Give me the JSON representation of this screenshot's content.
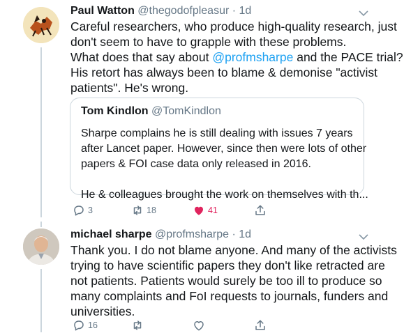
{
  "tweets": [
    {
      "name": "Paul Watton",
      "handle": "@thegodofpleasur",
      "time": "· 1d",
      "avatar": "painted-icon-avatar",
      "lines": [
        "Careful researchers, who produce high-quality research, just",
        "don't seem to have to grapple with these problems.",
        "What does that say about ",
        "@profmsharpe",
        " and the PACE trial?",
        "His retort has always been to blame & demonise \"activist",
        "patients\".  He's wrong."
      ],
      "quote": {
        "name": "Tom Kindlon",
        "handle": "@TomKindlon",
        "lines": [
          "Sharpe complains he is still dealing with issues 7 years",
          "after Lancet paper. However, since then were lots of other",
          "papers & FOI case data only released in 2016.",
          "",
          "He & colleagues brought the work on themselves with th..."
        ]
      },
      "actions": {
        "reply_count": "3",
        "retweet_count": "18",
        "like_count": "41",
        "liked": true,
        "reply_icon": "reply-icon",
        "retweet_icon": "retweet-icon",
        "like_icon": "heart-icon",
        "share_icon": "share-icon"
      }
    },
    {
      "name": "michael sharpe",
      "handle": "@profmsharpe",
      "time": "· 1d",
      "avatar": "photo-avatar",
      "lines": [
        "Thank you. I do not blame anyone. And many of the activists",
        "trying to have scientific papers they don't like retracted are",
        "not patients. Patients would surely be too ill to produce so",
        "many complaints and FoI requests to journals, funders and",
        "universities."
      ],
      "actions": {
        "reply_count": "16",
        "retweet_count": "",
        "like_count": "",
        "liked": false
      }
    }
  ],
  "colors": {
    "text": "#14171a",
    "muted": "#657786",
    "link": "#1da1f2",
    "like": "#e0245e",
    "border": "#ccd6dd"
  }
}
